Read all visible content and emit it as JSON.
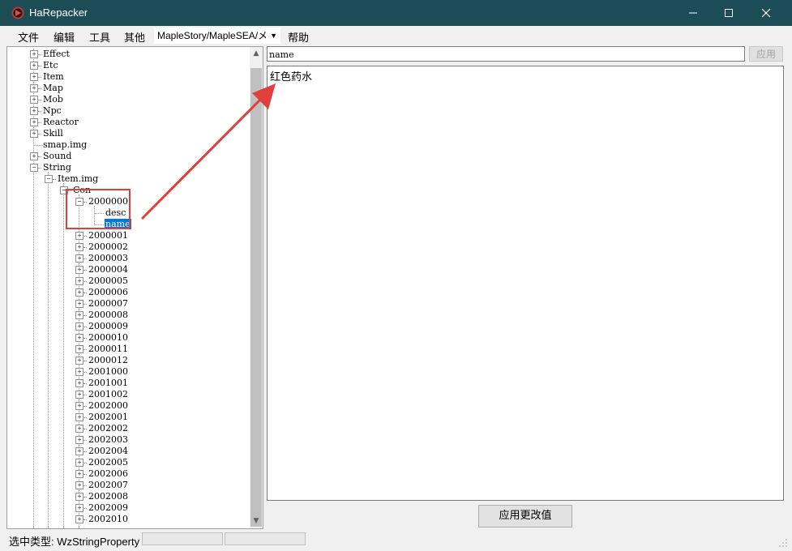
{
  "window": {
    "title": "HaRepacker",
    "icon": "harepacker-logo-icon",
    "controls": {
      "minimize": "minimize-icon",
      "maximize": "maximize-icon",
      "close": "close-icon"
    }
  },
  "menu": {
    "file": "文件",
    "edit": "编辑",
    "tools": "工具",
    "other": "其他",
    "path": "MapleStory/MapleSEA/メ",
    "help": "帮助"
  },
  "tree": {
    "roots": [
      "Effect",
      "Etc",
      "Item",
      "Map",
      "Mob",
      "Npc",
      "Reactor",
      "Skill",
      "smap.img",
      "Sound",
      "String"
    ],
    "string_child": "Item.img",
    "con_node": "Con",
    "expanded_item": "2000000",
    "expanded_children": [
      "desc",
      "name"
    ],
    "selected": "name",
    "items": [
      "2000001",
      "2000002",
      "2000003",
      "2000004",
      "2000005",
      "2000006",
      "2000007",
      "2000008",
      "2000009",
      "2000010",
      "2000011",
      "2000012",
      "2001000",
      "2001001",
      "2001002",
      "2002000",
      "2002001",
      "2002002",
      "2002003",
      "2002004",
      "2002005",
      "2002006",
      "2002007",
      "2002008",
      "2002009",
      "2002010"
    ]
  },
  "editor": {
    "name_value": "name",
    "apply_small": "应用",
    "value": "红色药水",
    "apply_button": "应用更改值"
  },
  "status": {
    "text": "选中类型: WzStringProperty"
  },
  "colors": {
    "titlebar": "#1c4d57",
    "selection": "#0078d7",
    "annotation": "#e0403c"
  }
}
